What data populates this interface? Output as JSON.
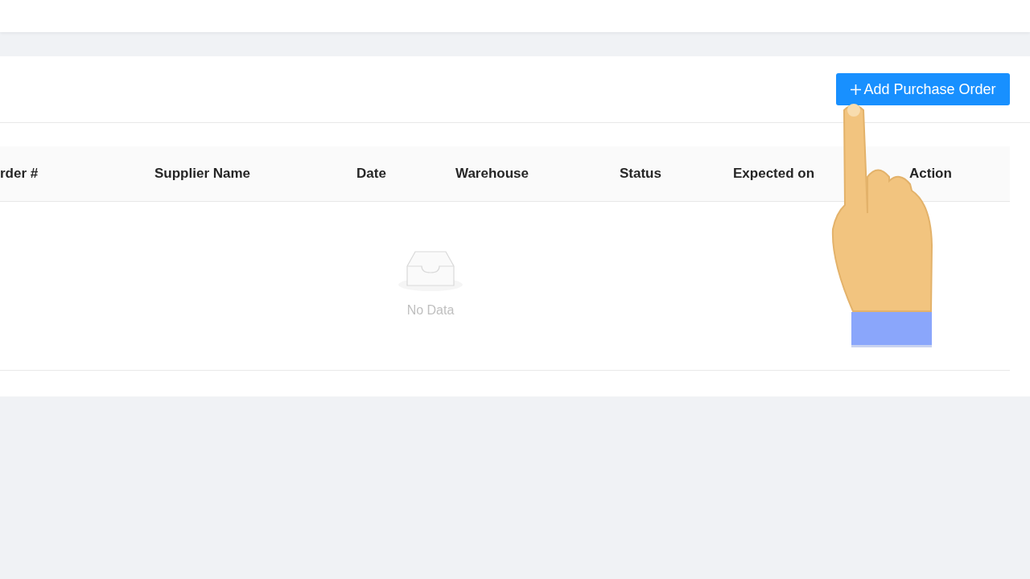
{
  "toolbar": {
    "add_button": {
      "label": "Add Purchase Order"
    }
  },
  "table": {
    "columns": [
      "rder #",
      "Supplier Name",
      "Date",
      "Warehouse",
      "Status",
      "Expected on",
      "Action"
    ],
    "empty_text": "No Data"
  }
}
